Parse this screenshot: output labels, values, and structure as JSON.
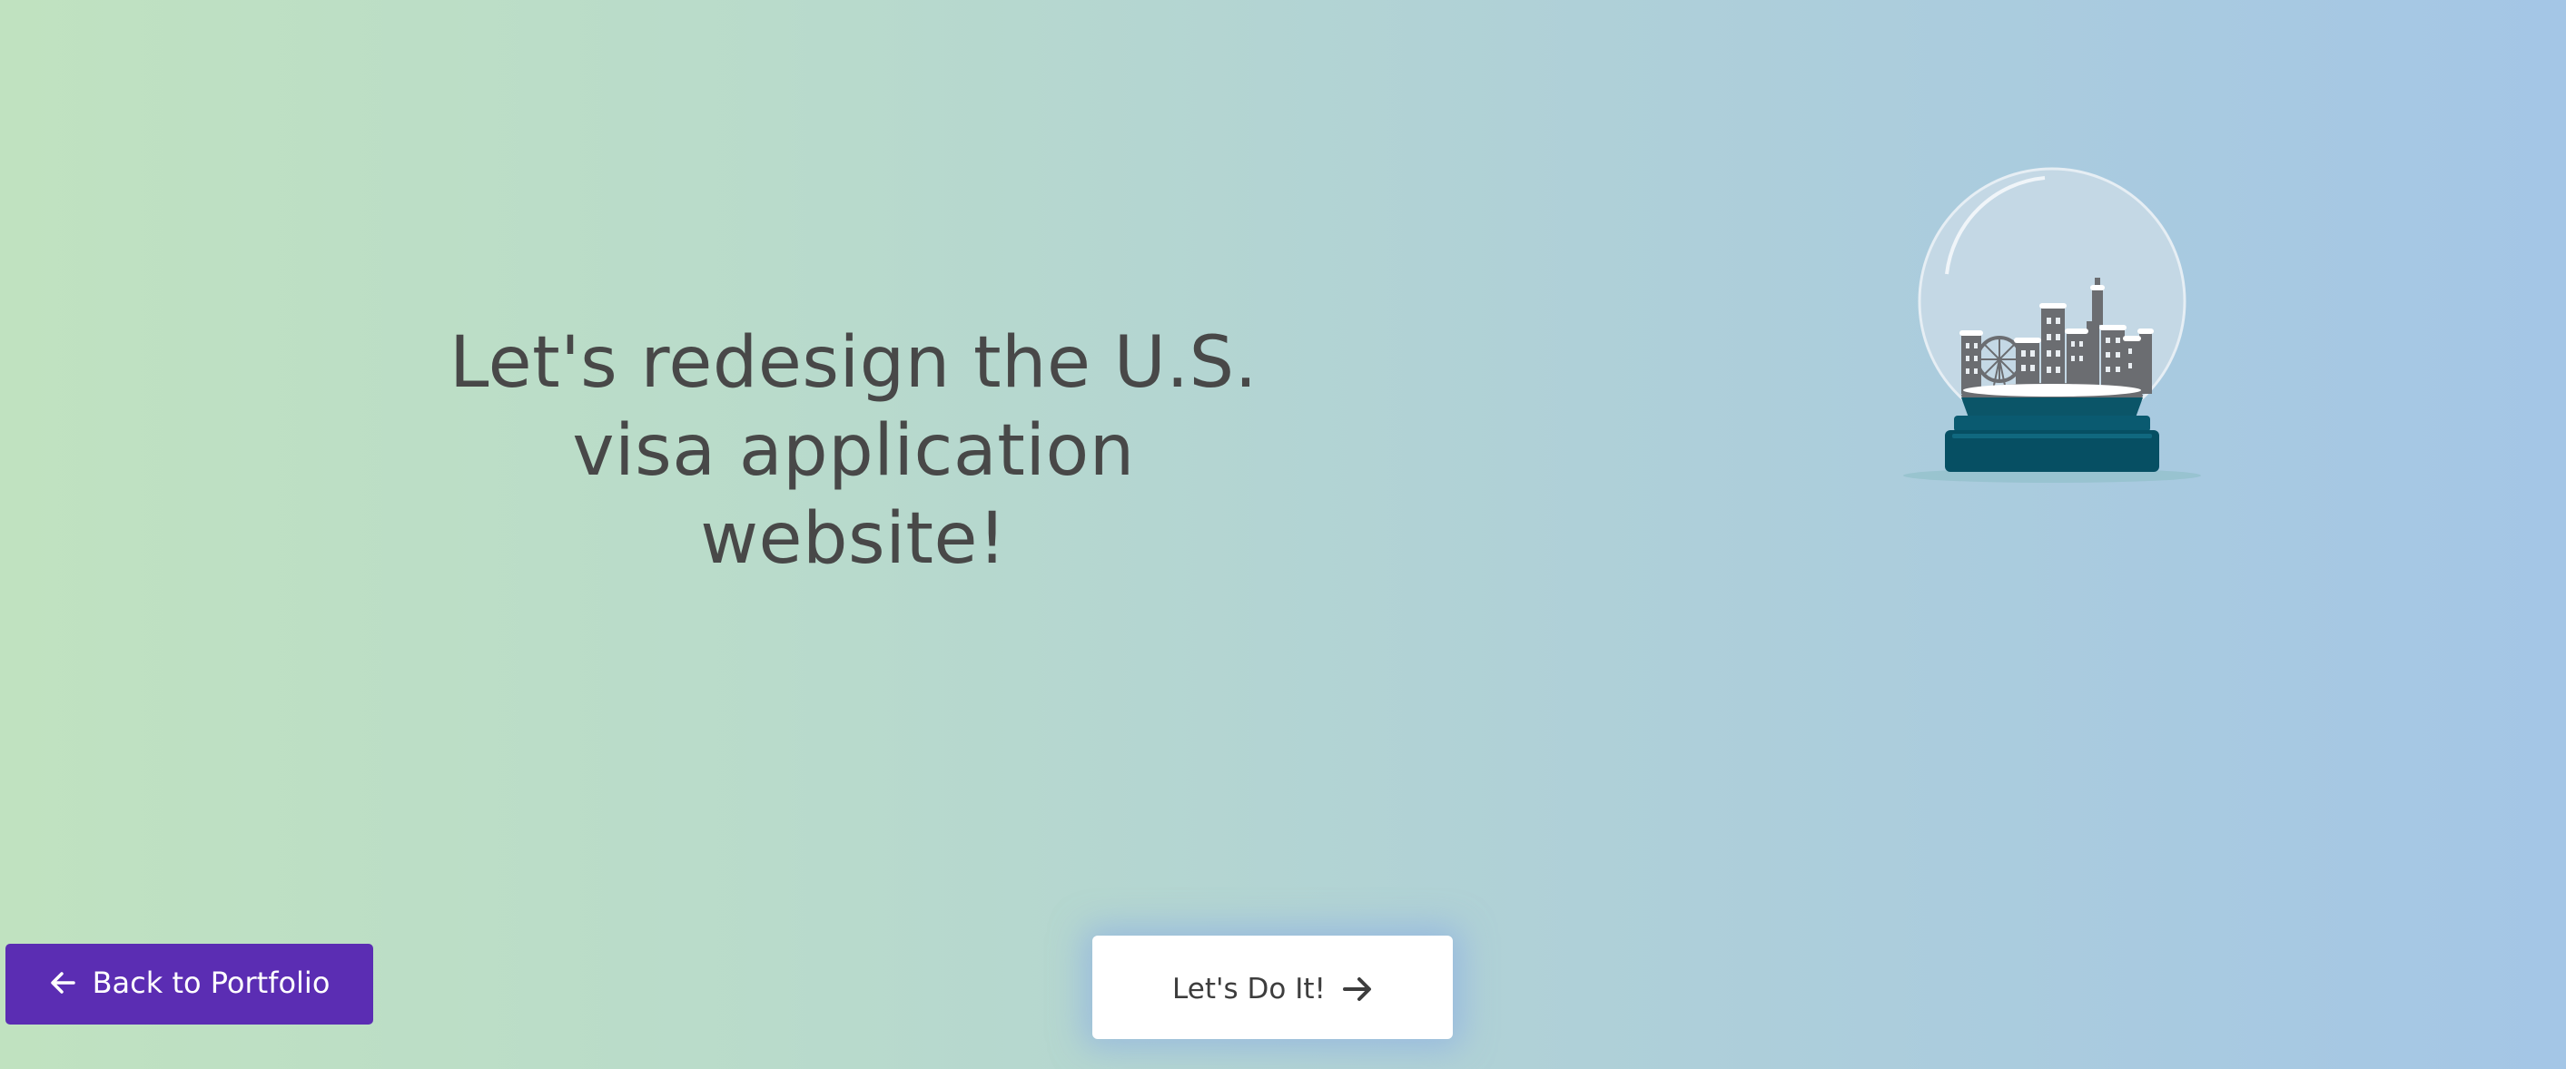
{
  "hero": {
    "headline": "Let's redesign the U.S.\nvisa application\nwebsite!"
  },
  "illustration": {
    "icon": "snow-globe-city-icon",
    "colors": {
      "glass": "#c9dbe8",
      "base": "#0a5a70",
      "buildings": "#6b6d71",
      "snow": "#ffffff"
    }
  },
  "nav": {
    "back_label": "Back to Portfolio",
    "back_icon": "arrow-left-icon",
    "cta_label": "Let's Do It!",
    "cta_icon": "arrow-right-icon"
  },
  "colors": {
    "back_button": "#5b2db3",
    "cta_button": "#ffffff",
    "headline_text": "#484848",
    "gradient_start": "#c0e2c0",
    "gradient_end": "#a4c6e6"
  }
}
